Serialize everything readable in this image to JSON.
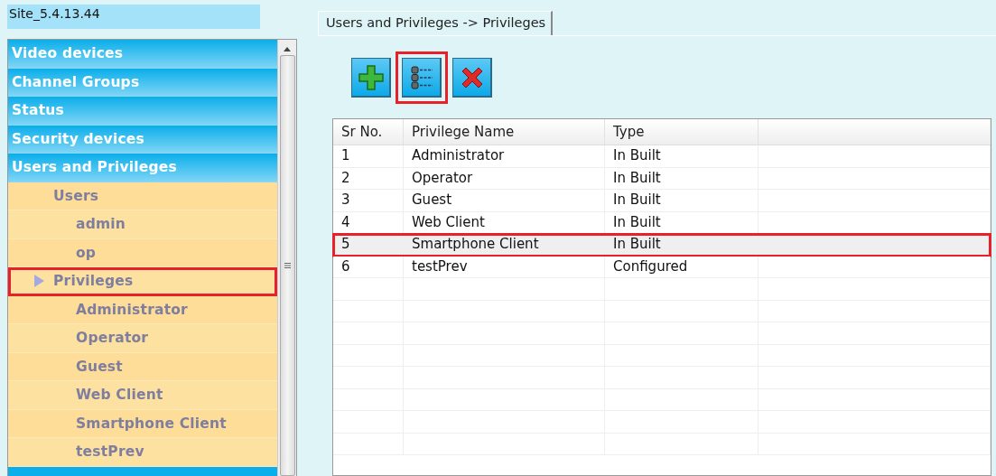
{
  "site": {
    "title": "Site_5.4.13.44"
  },
  "sidebar": {
    "items": [
      {
        "label": "Video devices",
        "selected": false
      },
      {
        "label": "Channel Groups",
        "selected": false
      },
      {
        "label": "Status",
        "selected": false
      },
      {
        "label": "Security devices",
        "selected": false
      },
      {
        "label": "Users and Privileges",
        "selected": false,
        "children": [
          {
            "label": "Users",
            "selected": false,
            "highlighted": false,
            "children": [
              {
                "label": "admin",
                "selected": false
              },
              {
                "label": "op",
                "selected": false
              }
            ]
          },
          {
            "label": "Privileges",
            "selected": true,
            "highlighted": true,
            "children": [
              {
                "label": "Administrator",
                "selected": false
              },
              {
                "label": "Operator",
                "selected": false
              },
              {
                "label": "Guest",
                "selected": false
              },
              {
                "label": "Web Client",
                "selected": false
              },
              {
                "label": "Smartphone Client",
                "selected": false
              },
              {
                "label": "testPrev",
                "selected": false
              }
            ]
          }
        ]
      }
    ]
  },
  "tabs": [
    {
      "label": "Users and Privileges -> Privileges",
      "selected": true
    }
  ],
  "toolbar": [
    {
      "kind": "add",
      "highlighted": false
    },
    {
      "kind": "details",
      "highlighted": true
    },
    {
      "kind": "delete",
      "highlighted": false
    }
  ],
  "table": {
    "columns": [
      "Sr No.",
      "Privilege Name",
      "Type"
    ],
    "rows": [
      {
        "cells": [
          "1",
          "Administrator",
          "In Built"
        ],
        "selected": false,
        "highlighted": false
      },
      {
        "cells": [
          "2",
          "Operator",
          "In Built"
        ],
        "selected": false,
        "highlighted": false
      },
      {
        "cells": [
          "3",
          "Guest",
          "In Built"
        ],
        "selected": false,
        "highlighted": false
      },
      {
        "cells": [
          "4",
          "Web Client",
          "In Built"
        ],
        "selected": false,
        "highlighted": false
      },
      {
        "cells": [
          "5",
          "Smartphone Client",
          "In Built"
        ],
        "selected": true,
        "highlighted": true
      },
      {
        "cells": [
          "6",
          "testPrev",
          "Configured"
        ],
        "selected": false,
        "highlighted": false
      }
    ]
  }
}
